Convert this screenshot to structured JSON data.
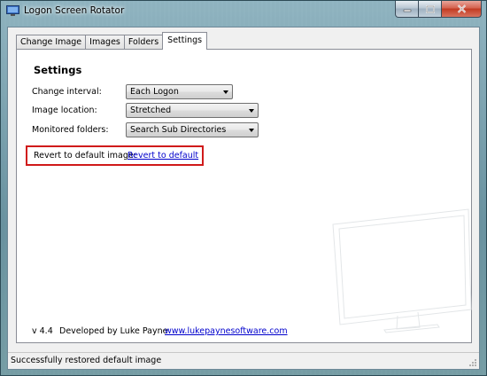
{
  "window": {
    "title": "Logon Screen Rotator",
    "controls": {
      "minimize_icon": "minimize-icon",
      "maximize_icon": "maximize-icon",
      "close_icon": "close-icon"
    }
  },
  "tabs": [
    {
      "label": "Change Image",
      "active": false
    },
    {
      "label": "Images",
      "active": false
    },
    {
      "label": "Folders",
      "active": false
    },
    {
      "label": "Settings",
      "active": true
    }
  ],
  "settings": {
    "heading": "Settings",
    "change_interval": {
      "label": "Change interval:",
      "value": "Each Logon"
    },
    "image_location": {
      "label": "Image location:",
      "value": "Stretched"
    },
    "monitored_folders": {
      "label": "Monitored folders:",
      "value": "Search Sub Directories"
    },
    "revert": {
      "label": "Revert to default image:",
      "link": "Revert to default"
    }
  },
  "footer": {
    "version": "v 4.4",
    "developer": "Developed by Luke Payne",
    "website": "www.lukepaynesoftware.com"
  },
  "status_bar": {
    "text": "Successfully restored default image"
  },
  "colors": {
    "highlight_box": "#d01a1a",
    "link": "#0000cc"
  }
}
